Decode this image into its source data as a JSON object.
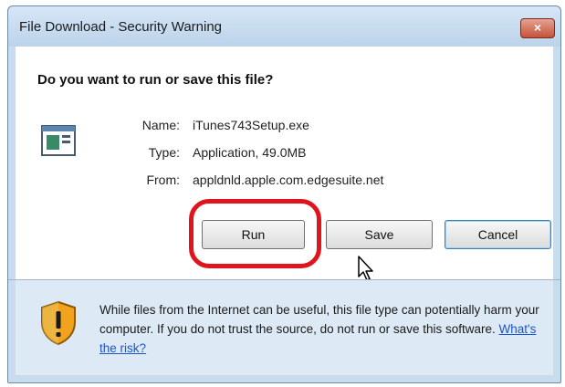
{
  "window": {
    "title": "File Download - Security Warning",
    "close_label": "×"
  },
  "dialog": {
    "question": "Do you want to run or save this file?",
    "file_icon": "application-icon",
    "fields": {
      "name_label": "Name:",
      "name_value": "iTunes743Setup.exe",
      "type_label": "Type:",
      "type_value": "Application, 49.0MB",
      "from_label": "From:",
      "from_value": "appldnld.apple.com.edgesuite.net"
    },
    "buttons": {
      "run": "Run",
      "save": "Save",
      "cancel": "Cancel"
    }
  },
  "annotation": {
    "highlight": "red-circle-around-run",
    "color": "#e0141e"
  },
  "footer": {
    "icon": "shield-warning-icon",
    "warning_text": "While files from the Internet can be useful, this file type can potentially harm your computer. If you do not trust the source, do not run or save this software.",
    "link_text": "What's the risk?"
  },
  "colors": {
    "frame": "#c9dcee",
    "footer_bg": "#dde9f5",
    "link": "#1b56c4"
  }
}
